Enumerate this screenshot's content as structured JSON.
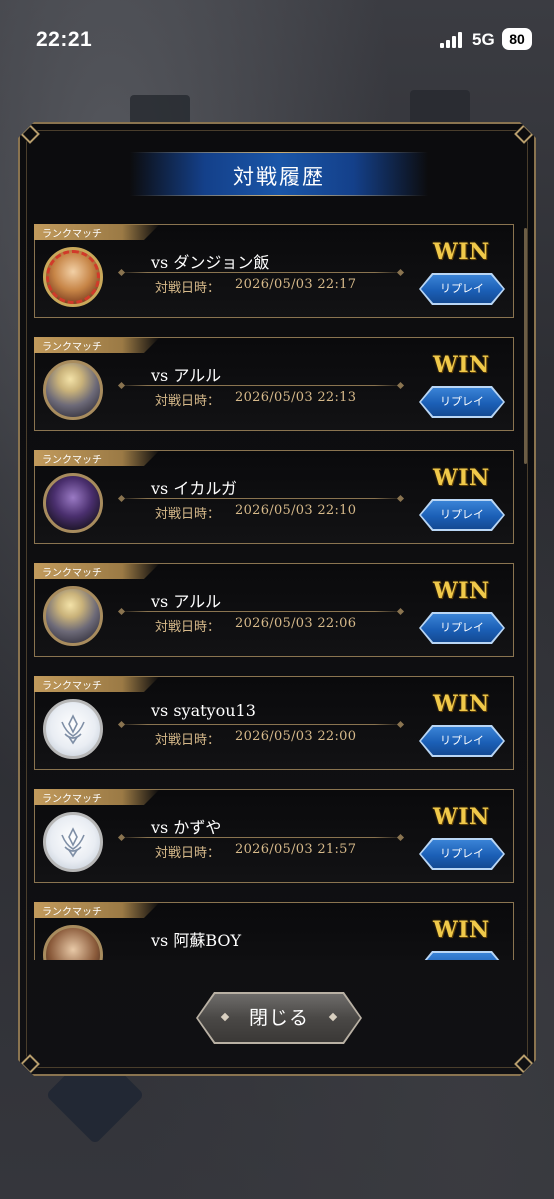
{
  "status_bar": {
    "time": "22:21",
    "network": "5G",
    "battery": "80"
  },
  "dialog": {
    "title": "対戦履歴",
    "close_label": "閉じる",
    "accent_gold": "#c19a5c",
    "accent_blue": "#1b5fb6"
  },
  "matches": [
    {
      "tag": "ランクマッチ",
      "opponent": "vs ダンジョン飯",
      "date_label": "対戦日時：",
      "date": "2026/05/03 22:17",
      "result": "WIN",
      "replay": "リプレイ",
      "avatar": "dungeon-avatar"
    },
    {
      "tag": "ランクマッチ",
      "opponent": "vs アルル",
      "date_label": "対戦日時：",
      "date": "2026/05/03 22:13",
      "result": "WIN",
      "replay": "リプレイ",
      "avatar": "aruru-avatar"
    },
    {
      "tag": "ランクマッチ",
      "opponent": "vs イカルガ",
      "date_label": "対戦日時：",
      "date": "2026/05/03 22:10",
      "result": "WIN",
      "replay": "リプレイ",
      "avatar": "ikaruga-avatar"
    },
    {
      "tag": "ランクマッチ",
      "opponent": "vs アルル",
      "date_label": "対戦日時：",
      "date": "2026/05/03 22:06",
      "result": "WIN",
      "replay": "リプレイ",
      "avatar": "aruru-avatar"
    },
    {
      "tag": "ランクマッチ",
      "opponent": "vs syatyou13",
      "date_label": "対戦日時：",
      "date": "2026/05/03 22:00",
      "result": "WIN",
      "replay": "リプレイ",
      "avatar": "emblem-avatar"
    },
    {
      "tag": "ランクマッチ",
      "opponent": "vs かずや",
      "date_label": "対戦日時：",
      "date": "2026/05/03 21:57",
      "result": "WIN",
      "replay": "リプレイ",
      "avatar": "emblem-avatar"
    },
    {
      "tag": "ランクマッチ",
      "opponent": "vs 阿蘇BOY",
      "result": "WIN",
      "avatar": "boy-avatar"
    }
  ]
}
